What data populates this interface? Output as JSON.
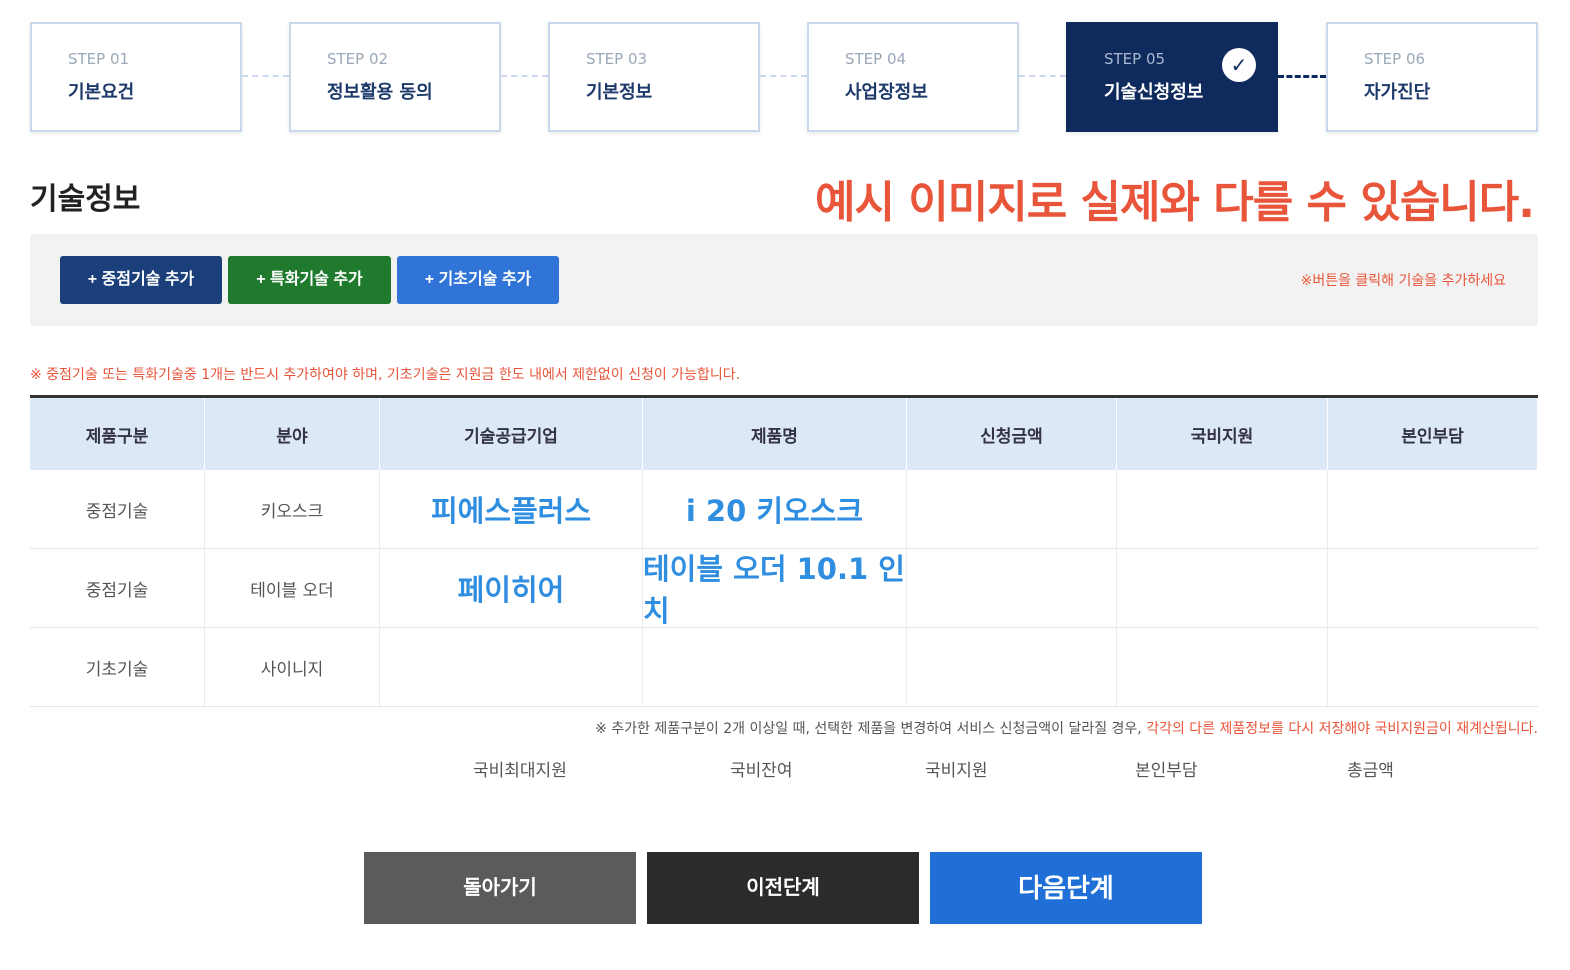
{
  "steps": [
    {
      "num": "STEP 01",
      "label": "기본요건"
    },
    {
      "num": "STEP 02",
      "label": "정보활용 동의"
    },
    {
      "num": "STEP 03",
      "label": "기본정보"
    },
    {
      "num": "STEP 04",
      "label": "사업장정보"
    },
    {
      "num": "STEP 05",
      "label": "기술신청정보"
    },
    {
      "num": "STEP 06",
      "label": "자가진단"
    }
  ],
  "active_step_check": "✓",
  "section_title": "기술정보",
  "example_note": "예시 이미지로 실제와 다를 수 있습니다.",
  "add_buttons": {
    "core": "+ 중점기술 추가",
    "special": "+ 특화기술 추가",
    "basic": "+ 기초기술 추가"
  },
  "panel_hint": "※버튼을 클릭해 기술을 추가하세요",
  "warning": "※ 중점기술 또는 특화기술중 1개는 반드시 추가하여야 하며, 기초기술은 지원금 한도 내에서 제한없이 신청이 가능합니다.",
  "table": {
    "headers": [
      "제품구분",
      "분야",
      "기술공급기업",
      "제품명",
      "신청금액",
      "국비지원",
      "본인부담"
    ],
    "rows": [
      [
        "중점기술",
        "키오스크",
        "피에스플러스",
        "i 20 키오스크",
        "",
        "",
        ""
      ],
      [
        "중점기술",
        "테이블 오더",
        "페이히어",
        "테이블 오더 10.1 인치",
        "",
        "",
        ""
      ],
      [
        "기초기술",
        "사이니지",
        "",
        "",
        "",
        "",
        ""
      ]
    ]
  },
  "table_note": {
    "plain": "※ 추가한 제품구분이 2개 이상일 때, 선택한 제품을 변경하여 서비스 신청금액이 달라질 경우, ",
    "red": "각각의 다른 제품정보를 다시 저장해야 국비지원금이 재계산됩니다."
  },
  "summary": [
    "국비최대지원",
    "국비잔여",
    "국비지원",
    "본인부담",
    "총금액"
  ],
  "bottom_buttons": {
    "back": "돌아가기",
    "prev": "이전단계",
    "next": "다음단계"
  }
}
